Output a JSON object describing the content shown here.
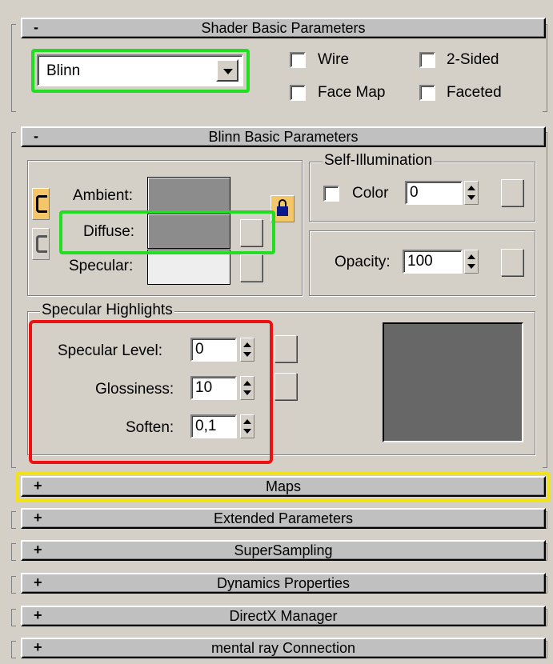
{
  "shader_basic": {
    "collapse_sign": "-",
    "title": "Shader Basic Parameters",
    "shader_type": "Blinn",
    "wire": "Wire",
    "two_sided": "2-Sided",
    "face_map": "Face Map",
    "faceted": "Faceted"
  },
  "blinn_basic": {
    "collapse_sign": "-",
    "title": "Blinn Basic Parameters",
    "ambient": "Ambient:",
    "diffuse": "Diffuse:",
    "specular": "Specular:",
    "self_illum_title": "Self-Illumination",
    "color_label": "Color",
    "color_value": "0",
    "opacity_label": "Opacity:",
    "opacity_value": "100",
    "ambient_color": "#8c8c8c",
    "diffuse_color": "#8c8c8c",
    "specular_color": "#eeeeee"
  },
  "specular_highlights": {
    "title": "Specular Highlights",
    "level_label": "Specular Level:",
    "level_value": "0",
    "gloss_label": "Glossiness:",
    "gloss_value": "10",
    "soften_label": "Soften:",
    "soften_value": "0,1",
    "preview_color": "#676767"
  },
  "rollouts": [
    {
      "sign": "+",
      "title": "Maps"
    },
    {
      "sign": "+",
      "title": "Extended Parameters"
    },
    {
      "sign": "+",
      "title": "SuperSampling"
    },
    {
      "sign": "+",
      "title": "Dynamics Properties"
    },
    {
      "sign": "+",
      "title": "DirectX Manager"
    },
    {
      "sign": "+",
      "title": "mental ray Connection"
    }
  ],
  "highlight_colors": {
    "green": "#22dd22",
    "red": "#ee1111",
    "yellow": "#f2e21a"
  }
}
